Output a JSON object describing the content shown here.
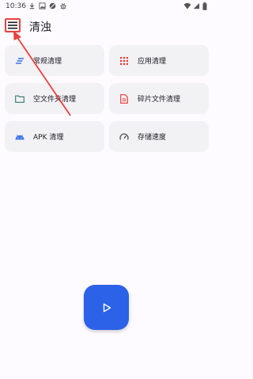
{
  "status_bar": {
    "time": "10:36",
    "icons": [
      "download-icon",
      "image-icon",
      "blocked-icon",
      "bug-icon",
      "wifi-icon",
      "signal-icon",
      "battery-icon"
    ]
  },
  "app_bar": {
    "title": "清浊",
    "menu_icon": "hamburger-menu-icon"
  },
  "cards": [
    {
      "label": "常规清理",
      "icon": "lines-icon",
      "color": "#3b73e8"
    },
    {
      "label": "应用清理",
      "icon": "grid-dots-icon",
      "color": "#e53935"
    },
    {
      "label": "空文件夹清理",
      "icon": "folder-icon",
      "color": "#2e7d6b"
    },
    {
      "label": "碎片文件清理",
      "icon": "document-icon",
      "color": "#e53935"
    },
    {
      "label": "APK 清理",
      "icon": "android-icon",
      "color": "#3b73e8"
    },
    {
      "label": "存储速度",
      "icon": "speedometer-icon",
      "color": "#444444"
    }
  ],
  "fab": {
    "icon": "play-icon",
    "color": "#2b62e8"
  },
  "annotation": {
    "color": "#e8413e"
  }
}
